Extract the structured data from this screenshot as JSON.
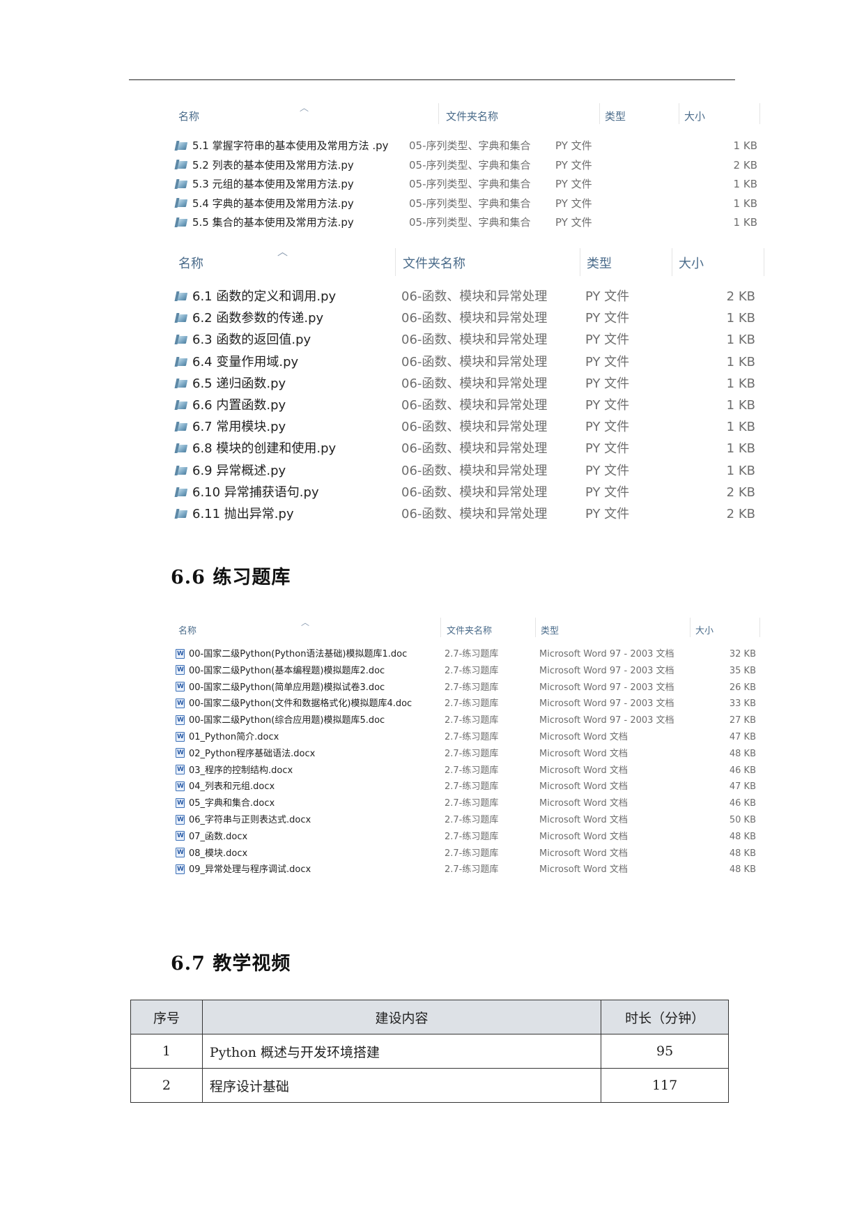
{
  "list_py_ch5": {
    "headers": {
      "name": "名称",
      "folder": "文件夹名称",
      "type": "类型",
      "size": "大小"
    },
    "rows": [
      {
        "name": "5.1 掌握字符串的基本使用及常用方法 .py",
        "folder": "05-序列类型、字典和集合",
        "type": "PY 文件",
        "size": "1 KB"
      },
      {
        "name": "5.2 列表的基本使用及常用方法.py",
        "folder": "05-序列类型、字典和集合",
        "type": "PY 文件",
        "size": "2 KB"
      },
      {
        "name": "5.3 元组的基本使用及常用方法.py",
        "folder": "05-序列类型、字典和集合",
        "type": "PY 文件",
        "size": "1 KB"
      },
      {
        "name": "5.4 字典的基本使用及常用方法.py",
        "folder": "05-序列类型、字典和集合",
        "type": "PY 文件",
        "size": "1 KB"
      },
      {
        "name": "5.5 集合的基本使用及常用方法.py",
        "folder": "05-序列类型、字典和集合",
        "type": "PY 文件",
        "size": "1 KB"
      }
    ]
  },
  "list_py_ch6": {
    "headers": {
      "name": "名称",
      "folder": "文件夹名称",
      "type": "类型",
      "size": "大小"
    },
    "rows": [
      {
        "name": "6.1 函数的定义和调用.py",
        "folder": "06-函数、模块和异常处理",
        "type": "PY 文件",
        "size": "2 KB"
      },
      {
        "name": "6.2 函数参数的传递.py",
        "folder": "06-函数、模块和异常处理",
        "type": "PY 文件",
        "size": "1 KB"
      },
      {
        "name": "6.3 函数的返回值.py",
        "folder": "06-函数、模块和异常处理",
        "type": "PY 文件",
        "size": "1 KB"
      },
      {
        "name": "6.4 变量作用域.py",
        "folder": "06-函数、模块和异常处理",
        "type": "PY 文件",
        "size": "1 KB"
      },
      {
        "name": "6.5 递归函数.py",
        "folder": "06-函数、模块和异常处理",
        "type": "PY 文件",
        "size": "1 KB"
      },
      {
        "name": "6.6 内置函数.py",
        "folder": "06-函数、模块和异常处理",
        "type": "PY 文件",
        "size": "1 KB"
      },
      {
        "name": "6.7 常用模块.py",
        "folder": "06-函数、模块和异常处理",
        "type": "PY 文件",
        "size": "1 KB"
      },
      {
        "name": "6.8 模块的创建和使用.py",
        "folder": "06-函数、模块和异常处理",
        "type": "PY 文件",
        "size": "1 KB"
      },
      {
        "name": "6.9 异常概述.py",
        "folder": "06-函数、模块和异常处理",
        "type": "PY 文件",
        "size": "1 KB"
      },
      {
        "name": "6.10 异常捕获语句.py",
        "folder": "06-函数、模块和异常处理",
        "type": "PY 文件",
        "size": "2 KB"
      },
      {
        "name": "6.11 抛出异常.py",
        "folder": "06-函数、模块和异常处理",
        "type": "PY 文件",
        "size": "2 KB"
      }
    ]
  },
  "section_66": {
    "title": "6.6 练习题库"
  },
  "list_docs": {
    "headers": {
      "name": "名称",
      "folder": "文件夹名称",
      "type": "类型",
      "size": "大小"
    },
    "rows": [
      {
        "name": "00-国家二级Python(Python语法基础)模拟题库1.doc",
        "folder": "2.7-练习题库",
        "type": "Microsoft Word 97 - 2003 文档",
        "size": "32 KB"
      },
      {
        "name": "00-国家二级Python(基本编程题)模拟题库2.doc",
        "folder": "2.7-练习题库",
        "type": "Microsoft Word 97 - 2003 文档",
        "size": "35 KB"
      },
      {
        "name": "00-国家二级Python(简单应用题)模拟试卷3.doc",
        "folder": "2.7-练习题库",
        "type": "Microsoft Word 97 - 2003 文档",
        "size": "26 KB"
      },
      {
        "name": "00-国家二级Python(文件和数据格式化)模拟题库4.doc",
        "folder": "2.7-练习题库",
        "type": "Microsoft Word 97 - 2003 文档",
        "size": "33 KB"
      },
      {
        "name": "00-国家二级Python(综合应用题)模拟题库5.doc",
        "folder": "2.7-练习题库",
        "type": "Microsoft Word 97 - 2003 文档",
        "size": "27 KB"
      },
      {
        "name": "01_Python简介.docx",
        "folder": "2.7-练习题库",
        "type": "Microsoft Word 文档",
        "size": "47 KB"
      },
      {
        "name": "02_Python程序基础语法.docx",
        "folder": "2.7-练习题库",
        "type": "Microsoft Word 文档",
        "size": "48 KB"
      },
      {
        "name": "03_程序的控制结构.docx",
        "folder": "2.7-练习题库",
        "type": "Microsoft Word 文档",
        "size": "46 KB"
      },
      {
        "name": "04_列表和元组.docx",
        "folder": "2.7-练习题库",
        "type": "Microsoft Word 文档",
        "size": "47 KB"
      },
      {
        "name": "05_字典和集合.docx",
        "folder": "2.7-练习题库",
        "type": "Microsoft Word 文档",
        "size": "46 KB"
      },
      {
        "name": "06_字符串与正则表达式.docx",
        "folder": "2.7-练习题库",
        "type": "Microsoft Word 文档",
        "size": "50 KB"
      },
      {
        "name": "07_函数.docx",
        "folder": "2.7-练习题库",
        "type": "Microsoft Word 文档",
        "size": "48 KB"
      },
      {
        "name": "08_模块.docx",
        "folder": "2.7-练习题库",
        "type": "Microsoft Word 文档",
        "size": "48 KB"
      },
      {
        "name": "09_异常处理与程序调试.docx",
        "folder": "2.7-练习题库",
        "type": "Microsoft Word 文档",
        "size": "48 KB"
      }
    ]
  },
  "section_67": {
    "title": "6.7 教学视频"
  },
  "video_table": {
    "headers": {
      "index": "序号",
      "content": "建设内容",
      "duration": "时长（分钟）"
    },
    "rows": [
      {
        "index": "1",
        "content": "Python 概述与开发环境搭建",
        "duration": "95"
      },
      {
        "index": "2",
        "content": "程序设计基础",
        "duration": "117"
      }
    ]
  }
}
